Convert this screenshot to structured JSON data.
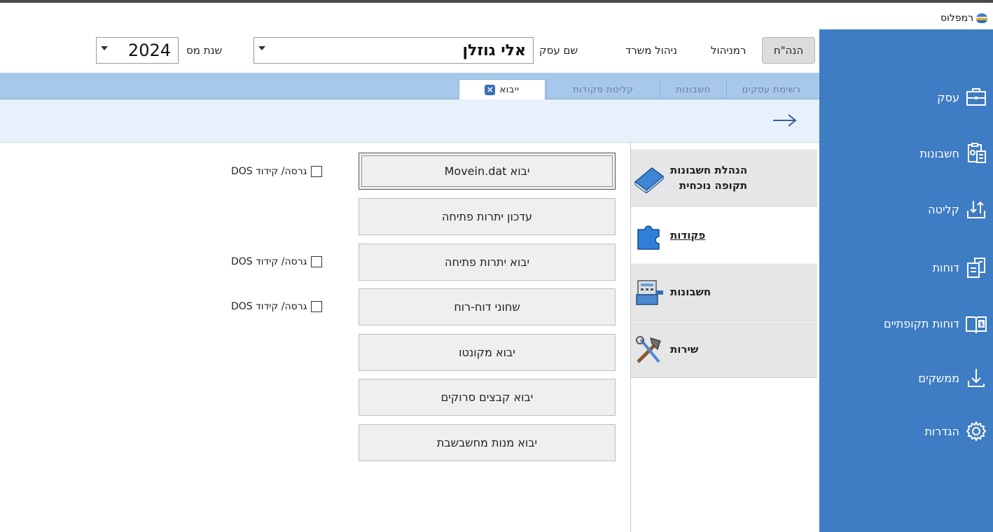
{
  "app": {
    "title": "רמפלוס"
  },
  "top": {
    "tabs": [
      {
        "label": "הנה\"ח"
      },
      {
        "label": "רמניהול"
      },
      {
        "label": "ניהול משרד"
      }
    ],
    "business_label": "שם עסק",
    "business_value": "אלי גוזלן",
    "tax_year_label": "שנת מס",
    "tax_year_value": "2024"
  },
  "sidebar": {
    "items": [
      {
        "label": "עסק",
        "icon": "briefcase-icon"
      },
      {
        "label": "חשבונות",
        "icon": "calculator-clipboard-icon"
      },
      {
        "label": "קליטה",
        "icon": "inbox-arrows-icon"
      },
      {
        "label": "דוחות",
        "icon": "reports-icon"
      },
      {
        "label": "דוחות תקופתיים",
        "icon": "periodic-report-book-icon"
      },
      {
        "label": "ממשקים",
        "icon": "interface-download-icon"
      },
      {
        "label": "הגדרות",
        "icon": "gear-icon"
      }
    ]
  },
  "tabstrip": {
    "tabs": [
      {
        "label": "רשימת עסקים"
      },
      {
        "label": "חשבונות"
      },
      {
        "label": "קליטת פקודות"
      },
      {
        "label": "ייבוא"
      }
    ]
  },
  "menu": {
    "items": [
      {
        "label_line1": "הנהלת חשבונות",
        "label_line2": "תקופה נוכחית",
        "icon": "book-icon"
      },
      {
        "label": "פקודות",
        "icon": "puzzle-icon"
      },
      {
        "label": "חשבונות",
        "icon": "cash-register-icon"
      },
      {
        "label": "שירות",
        "icon": "tools-icon"
      }
    ]
  },
  "actions": {
    "buttons": [
      {
        "label": "יבוא Movein.dat",
        "dos": true
      },
      {
        "label": "עדכון יתרות פתיחה",
        "dos": false
      },
      {
        "label": "יבוא יתרות פתיחה",
        "dos": true
      },
      {
        "label": "שחוני דוח-רוח",
        "dos": true
      },
      {
        "label": "יבוא מקונטו",
        "dos": false
      },
      {
        "label": "יבוא קבצים סרוקים",
        "dos": false
      },
      {
        "label": "יבוא מנות מחשבשבת",
        "dos": false
      }
    ],
    "dos_label": "גרסה/ קידוד DOS"
  }
}
